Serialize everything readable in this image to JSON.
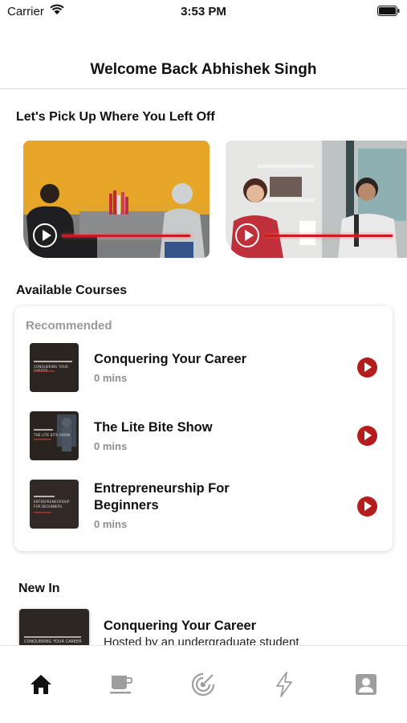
{
  "status_bar": {
    "carrier": "Carrier",
    "time": "3:53 PM"
  },
  "header": {
    "title": "Welcome Back Abhishek Singh"
  },
  "continue_watching": {
    "title": "Let's Pick Up Where You Left Off",
    "videos": [
      {
        "progress": 0.95
      },
      {
        "progress": 0.95
      }
    ]
  },
  "courses": {
    "title": "Available Courses",
    "card_label": "Recommended",
    "items": [
      {
        "name": "Conquering Your Career",
        "duration": "0 mins",
        "thumb_text": "CONQUERING YOUR CAREER"
      },
      {
        "name": "The Lite Bite Show",
        "duration": "0 mins",
        "thumb_text": "THE LITE BITE SHOW"
      },
      {
        "name": "Entrepreneurship For Beginners",
        "duration": "0 mins",
        "thumb_text": "ENTREPRENEURSHIP FOR BEGINNERS"
      }
    ]
  },
  "new_in": {
    "title": "New In",
    "items": [
      {
        "name": "Conquering Your Career",
        "host": "Hosted by an undergraduate student",
        "thumb_text": "CONQUERING YOUR CAREER"
      }
    ]
  },
  "tab_bar": {
    "active_color": "#111111",
    "inactive_color": "#9e9e9e",
    "tabs": [
      {
        "icon": "home-icon",
        "active": true
      },
      {
        "icon": "coffee-cup-icon",
        "active": false
      },
      {
        "icon": "radar-icon",
        "active": false
      },
      {
        "icon": "lightning-icon",
        "active": false
      },
      {
        "icon": "profile-icon",
        "active": false
      }
    ]
  },
  "colors": {
    "accent": "#b51c1c",
    "muted": "#9a9a9a"
  }
}
